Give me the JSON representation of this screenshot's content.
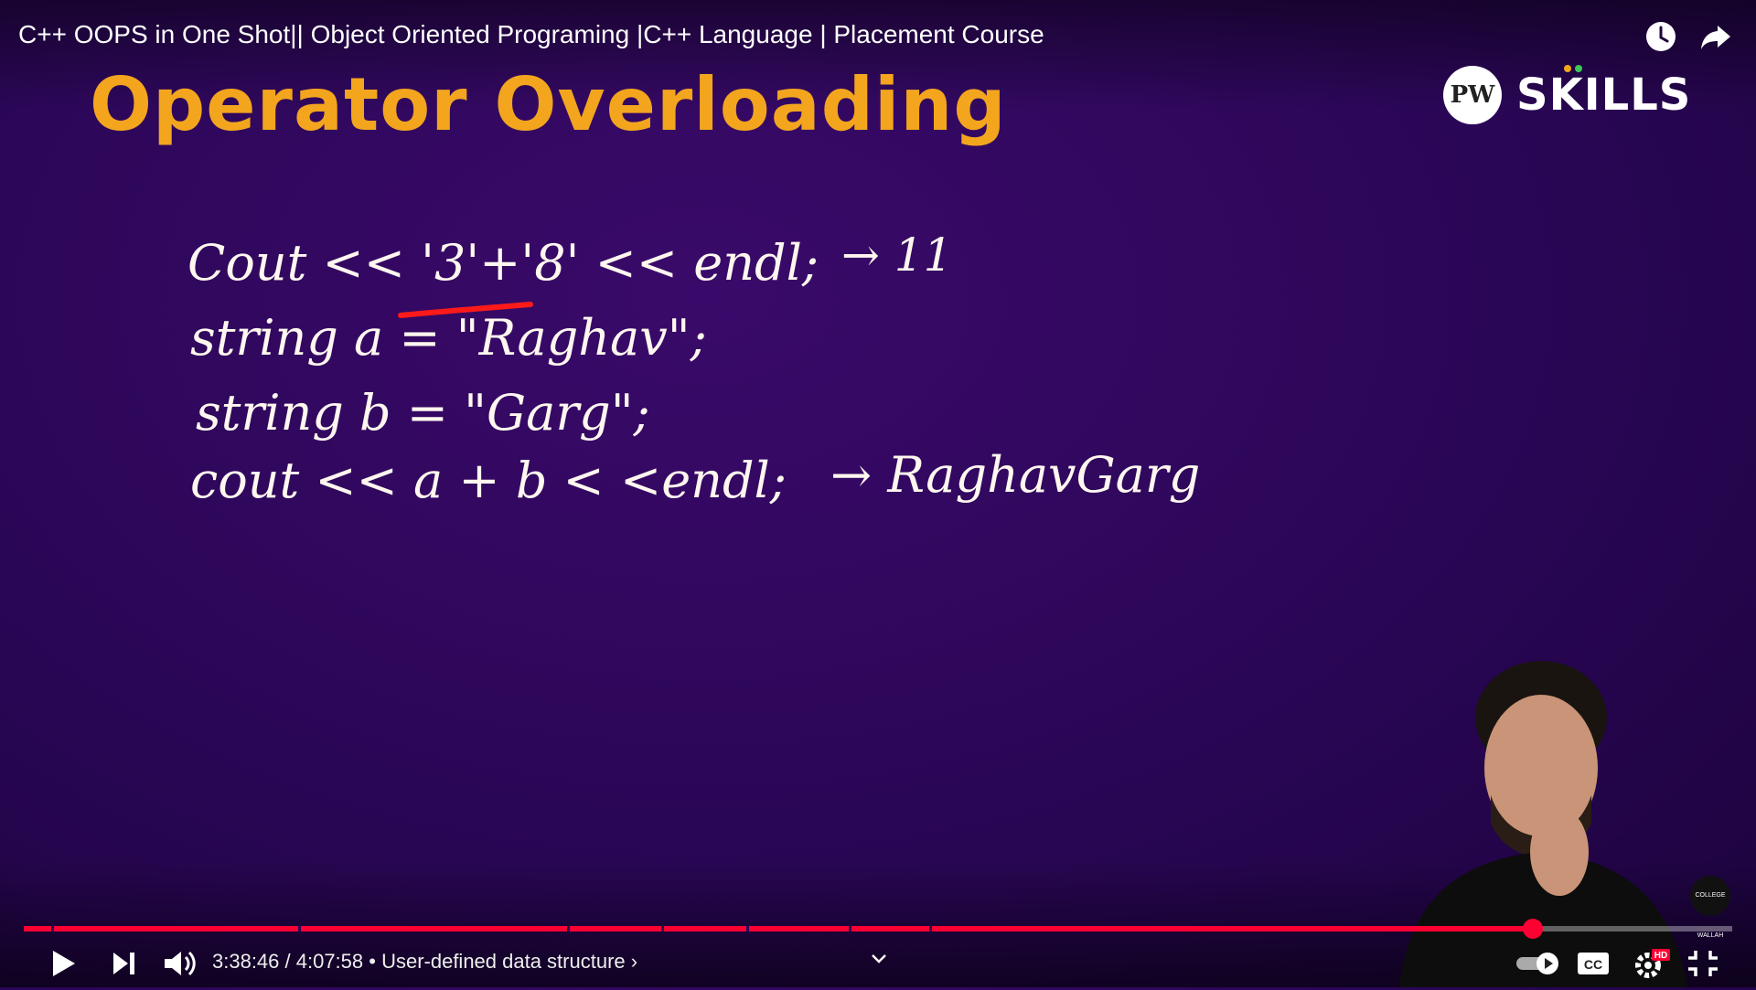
{
  "video": {
    "title": "C++ OOPS in One Shot|| Object Oriented Programing |C++ Language | Placement Course"
  },
  "slide": {
    "heading": "Operator Overloading",
    "logo_text": "SKILLS",
    "logo_mark": "PW",
    "badge_text": "COLLEGE WALLAH",
    "lines": [
      "Cout << '3'+'8' << endl;",
      "→ 11",
      "string a = \"Raghav\";",
      "string b = \"Garg\";",
      "cout << a + b < <endl;",
      "→ RaghavGarg"
    ]
  },
  "player": {
    "time_current": "3:38:46",
    "time_total": "4:07:58",
    "time_display": "3:38:46 / 4:07:58 • User-defined data structure ›",
    "chapter": "User-defined data structure",
    "progress": 0.8832,
    "hd_badge": "HD",
    "cc_label": "CC",
    "icons": [
      "play-icon",
      "next-icon",
      "volume-icon",
      "autoplay-toggle",
      "cc-icon",
      "settings-icon",
      "exit-fullscreen-icon",
      "watch-later-icon",
      "share-icon"
    ],
    "accent_color": "#ff0033"
  }
}
